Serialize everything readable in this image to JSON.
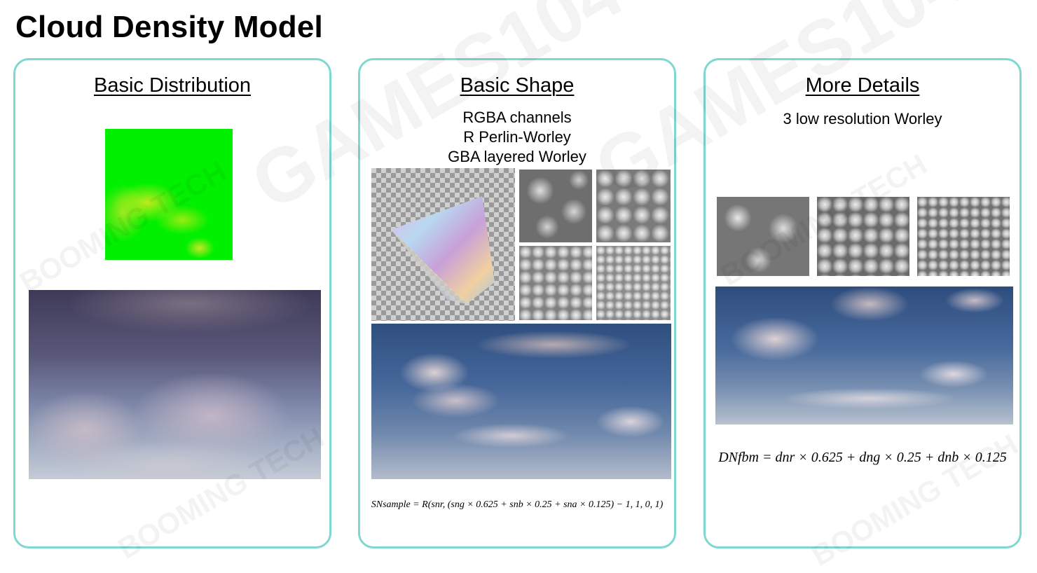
{
  "slide": {
    "title": "Cloud Density Model"
  },
  "watermark": {
    "brand_text": "GAMES104",
    "logo_text": "BOOMING TECH"
  },
  "panels": [
    {
      "heading": "Basic Distribution"
    },
    {
      "heading": "Basic Shape",
      "subtitle_lines": [
        "RGBA channels",
        "R Perlin-Worley",
        "GBA layered Worley"
      ],
      "formula": "SNsample = R(snr, (sng × 0.625 + snb × 0.25 + sna × 0.125) − 1, 1, 0, 1)"
    },
    {
      "heading": "More Details",
      "subtitle_lines": [
        "3 low resolution Worley"
      ],
      "formula": "DNfbm = dnr × 0.625 + dng × 0.25 + dnb × 0.125"
    }
  ]
}
